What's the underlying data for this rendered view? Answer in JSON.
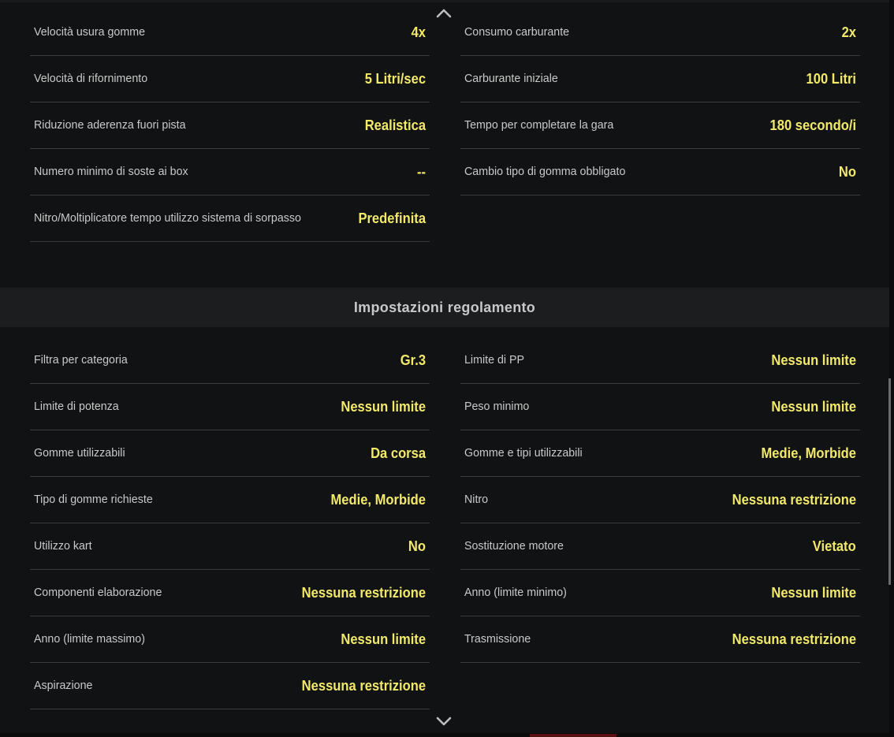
{
  "race_settings": {
    "left": [
      {
        "label": "Velocità usura gomme",
        "value": "4x"
      },
      {
        "label": "Velocità di rifornimento",
        "value": "5 Litri/sec"
      },
      {
        "label": "Riduzione aderenza fuori pista",
        "value": "Realistica"
      },
      {
        "label": "Numero minimo di soste ai box",
        "value": "--"
      },
      {
        "label": "Nitro/Moltiplicatore tempo utilizzo sistema di sorpasso",
        "value": "Predefinita"
      }
    ],
    "right": [
      {
        "label": "Consumo carburante",
        "value": "2x"
      },
      {
        "label": "Carburante iniziale",
        "value": "100 Litri"
      },
      {
        "label": "Tempo per completare la gara",
        "value": "180 secondo/i"
      },
      {
        "label": "Cambio tipo di gomma obbligato",
        "value": "No"
      }
    ]
  },
  "regulations": {
    "title": "Impostazioni regolamento",
    "left": [
      {
        "label": "Filtra per categoria",
        "value": "Gr.3"
      },
      {
        "label": "Limite di potenza",
        "value": "Nessun limite"
      },
      {
        "label": "Gomme utilizzabili",
        "value": "Da corsa"
      },
      {
        "label": "Tipo di gomme richieste",
        "value": "Medie, Morbide"
      },
      {
        "label": "Utilizzo kart",
        "value": "No"
      },
      {
        "label": "Componenti elaborazione",
        "value": "Nessuna restrizione"
      },
      {
        "label": "Anno (limite massimo)",
        "value": "Nessun limite"
      },
      {
        "label": "Aspirazione",
        "value": "Nessuna restrizione"
      }
    ],
    "right": [
      {
        "label": "Limite di PP",
        "value": "Nessun limite"
      },
      {
        "label": "Peso minimo",
        "value": "Nessun limite"
      },
      {
        "label": "Gomme e tipi utilizzabili",
        "value": "Medie, Morbide"
      },
      {
        "label": "Nitro",
        "value": "Nessuna restrizione"
      },
      {
        "label": "Sostituzione motore",
        "value": "Vietato"
      },
      {
        "label": "Anno (limite minimo)",
        "value": "Nessun limite"
      },
      {
        "label": "Trasmissione",
        "value": "Nessuna restrizione"
      }
    ]
  },
  "icons": {
    "scroll_up": "chevron-up-icon",
    "scroll_down": "chevron-down-icon"
  },
  "colors": {
    "value_text": "#f2e96b",
    "label_text": "#c9c9c9",
    "background": "#111213"
  }
}
